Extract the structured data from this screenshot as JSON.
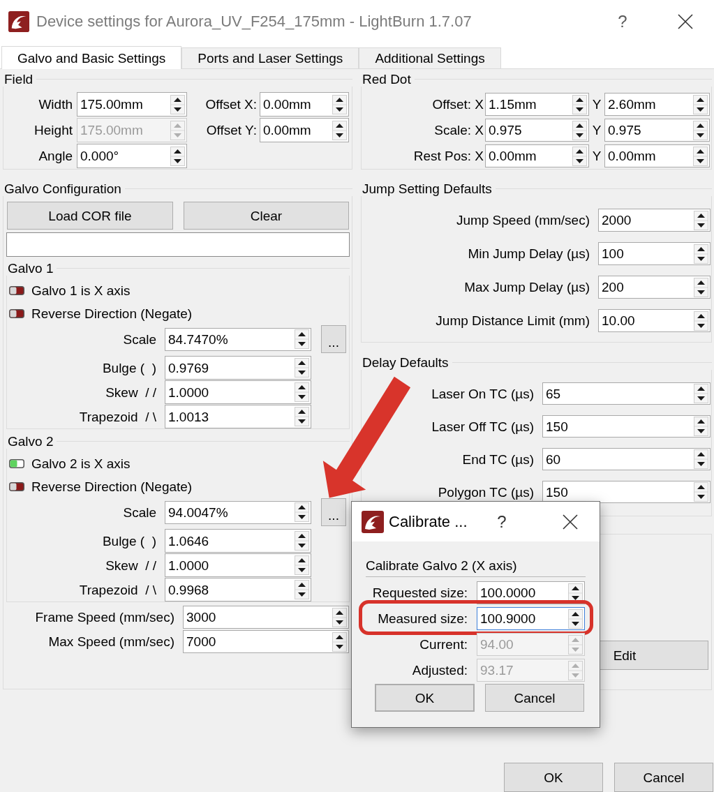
{
  "window": {
    "title": "Device settings for Aurora_UV_F254_175mm - LightBurn 1.7.07",
    "help_button": "?"
  },
  "tabs": [
    {
      "label": "Galvo and Basic Settings",
      "selected": true
    },
    {
      "label": "Ports and Laser Settings",
      "selected": false
    },
    {
      "label": "Additional Settings",
      "selected": false
    }
  ],
  "field": {
    "title": "Field",
    "size_fields": [
      {
        "label": "Width",
        "value": "175.00mm",
        "disabled": false
      },
      {
        "label": "Height",
        "value": "175.00mm",
        "disabled": true
      },
      {
        "label": "Angle",
        "value": "0.000°",
        "disabled": false
      }
    ],
    "offset_fields": [
      {
        "label": "Offset X:",
        "value": "0.00mm",
        "disabled": false
      },
      {
        "label": "Offset Y:",
        "value": "0.00mm",
        "disabled": false
      }
    ]
  },
  "red_dot": {
    "title": "Red Dot",
    "rows": [
      {
        "label": "Offset: X",
        "x_value": "1.15mm",
        "y_label": "Y",
        "y_value": "2.60mm"
      },
      {
        "label": "Scale: X",
        "x_value": "0.975",
        "y_label": "Y",
        "y_value": "0.975"
      },
      {
        "label": "Rest Pos: X",
        "x_value": "0.00mm",
        "y_label": "Y",
        "y_value": "0.00mm"
      }
    ]
  },
  "galvo_configuration": {
    "title": "Galvo Configuration",
    "buttons": [
      "Load COR file",
      "Clear"
    ],
    "galvos": [
      {
        "title": "Galvo 1",
        "toggles": [
          {
            "label": "Galvo 1 is X axis",
            "on": false
          },
          {
            "label": "Reverse Direction (Negate)",
            "on": false
          }
        ],
        "params": [
          {
            "label": "Scale",
            "value": "84.7470%"
          },
          {
            "label": "Bulge (  )",
            "value": "0.9769"
          },
          {
            "label": "Skew  / /",
            "value": "1.0000"
          },
          {
            "label": "Trapezoid  / \\",
            "value": "1.0013"
          }
        ],
        "calibrate_button": "..."
      },
      {
        "title": "Galvo 2",
        "toggles": [
          {
            "label": "Galvo 2 is X axis",
            "on": true
          },
          {
            "label": "Reverse Direction (Negate)",
            "on": false
          }
        ],
        "params": [
          {
            "label": "Scale",
            "value": "94.0047%"
          },
          {
            "label": "Bulge (  )",
            "value": "1.0646"
          },
          {
            "label": "Skew  / /",
            "value": "1.0000"
          },
          {
            "label": "Trapezoid  / \\",
            "value": "0.9968"
          }
        ],
        "calibrate_button": "..."
      }
    ],
    "speeds": [
      {
        "label": "Frame Speed (mm/sec)",
        "value": "3000"
      },
      {
        "label": "Max Speed (mm/sec)",
        "value": "7000"
      }
    ]
  },
  "jump_setting_defaults": {
    "title": "Jump Setting Defaults",
    "rows": [
      {
        "label": "Jump Speed (mm/sec)",
        "value": "2000"
      },
      {
        "label": "Min Jump Delay (µs)",
        "value": "100"
      },
      {
        "label": "Max Jump Delay (µs)",
        "value": "200"
      },
      {
        "label": "Jump Distance Limit (mm)",
        "value": "10.00"
      }
    ]
  },
  "delay_defaults": {
    "title": "Delay Defaults",
    "rows": [
      {
        "label": "Laser On TC (µs)",
        "value": "65"
      },
      {
        "label": "Laser Off TC (µs)",
        "value": "150"
      },
      {
        "label": "End TC (µs)",
        "value": "60"
      },
      {
        "label": "Polygon TC (µs)",
        "value": "150"
      }
    ]
  },
  "edit_button": "Edit",
  "footer_buttons": [
    "OK",
    "Cancel"
  ],
  "calibrate_dialog": {
    "title": "Calibrate ...",
    "help_button": "?",
    "heading": "Calibrate Galvo 2 (X axis)",
    "rows": [
      {
        "label": "Requested size:",
        "value": "100.0000",
        "disabled": false,
        "focused": false,
        "highlighted": false
      },
      {
        "label": "Measured size:",
        "value": "100.9000",
        "disabled": false,
        "focused": true,
        "highlighted": true
      },
      {
        "label": "Current:",
        "value": "94.00",
        "disabled": true,
        "focused": false,
        "highlighted": false
      },
      {
        "label": "Adjusted:",
        "value": "93.17",
        "disabled": true,
        "focused": false,
        "highlighted": false
      }
    ],
    "buttons": [
      {
        "label": "OK",
        "default": true
      },
      {
        "label": "Cancel",
        "default": false
      }
    ]
  }
}
